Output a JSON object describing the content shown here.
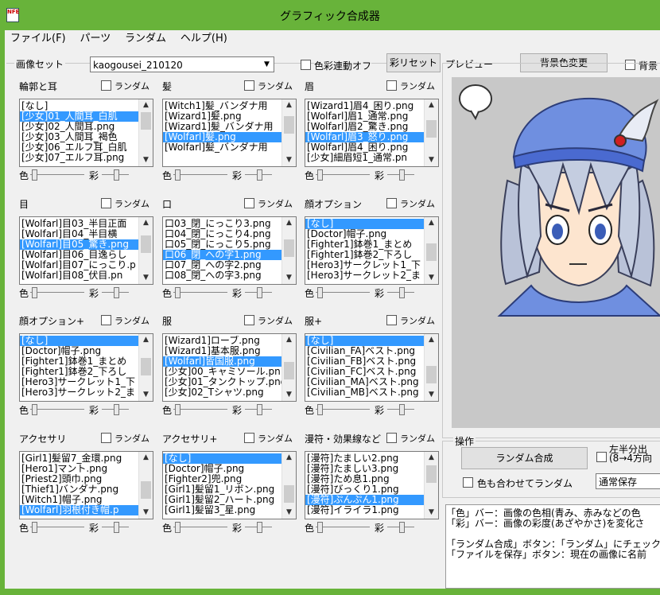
{
  "window": {
    "title": "グラフィック合成器",
    "icon_text": "NFE"
  },
  "menu": [
    "ファイル(F)",
    "パーツ",
    "ランダム",
    "ヘルプ(H)"
  ],
  "image_set": {
    "label": "画像セット",
    "value": "kaogousei_210120",
    "color_link_label": "色彩連動オフ",
    "color_reset_button": "彩リセット"
  },
  "preview": {
    "label": "プレビュー",
    "bg_button": "背景色変更",
    "bg_check_label": "背景",
    "bg_color": "#c8c8c8"
  },
  "common": {
    "random": "ランダム",
    "color": "色",
    "sat": "彩"
  },
  "parts": [
    {
      "label": "輪郭と耳",
      "items": [
        "[なし]",
        "[少女]01_人間耳_白肌",
        "[少女]02_人間耳.png",
        "[少女]03_人間耳_褐色",
        "[少女]06_エルフ耳_白肌",
        "[少女]07_エルフ耳.png"
      ],
      "selected": 1
    },
    {
      "label": "髪",
      "items": [
        "[Witch1]髪_バンダナ用",
        "[Wizard1]髪.png",
        "[Wizard1]髪_バンダナ用",
        "[Wolfarl]髪.png",
        "[Wolfarl]髪_バンダナ用"
      ],
      "selected": 3
    },
    {
      "label": "眉",
      "items": [
        "[Wizard1]眉4_困り.png",
        "[Wolfarl]眉1_通常.png",
        "[Wolfarl]眉2_驚き.png",
        "[Wolfarl]眉3_怒り.png",
        "[Wolfarl]眉4_困り.png",
        "[少女]細眉短1_通常.pn"
      ],
      "selected": 3
    },
    {
      "label": "目",
      "items": [
        "[Wolfarl]目03_半目正面",
        "[Wolfarl]目04_半目横",
        "[Wolfarl]目05_驚き.png",
        "[Wolfarl]目06_目逸らし",
        "[Wolfarl]目07_にっこり.p",
        "[Wolfarl]目08_伏目.pn"
      ],
      "selected": 2
    },
    {
      "label": "口",
      "items": [
        "口03_閉_にっこり3.png",
        "口04_閉_にっこり4.png",
        "口05_閉_にっこり5.png",
        "口06_閉_への字1.png",
        "口07_閉_への字2.png",
        "口08_閉_への字3.png"
      ],
      "selected": 3
    },
    {
      "label": "顔オプション",
      "items": [
        "[なし]",
        "[Doctor]帽子.png",
        "[Fighter1]鉢巻1_まとめ",
        "[Fighter1]鉢巻2_下ろし",
        "[Hero3]サークレット1_下",
        "[Hero3]サークレット2_ま"
      ],
      "selected": 0
    },
    {
      "label": "顔オプション+",
      "items": [
        "[なし]",
        "[Doctor]帽子.png",
        "[Fighter1]鉢巻1_まとめ",
        "[Fighter1]鉢巻2_下ろし",
        "[Hero3]サークレット1_下",
        "[Hero3]サークレット2_ま"
      ],
      "selected": 0
    },
    {
      "label": "服",
      "items": [
        "[Wizard1]ローブ.png",
        "[Wizard1]基本服.png",
        "[Wolfarl]皆国服.png",
        "[少女]00_キャミソール.pn",
        "[少女]01_タンクトップ.png",
        "[少女]02_Tシャツ.png"
      ],
      "selected": 2
    },
    {
      "label": "服+",
      "items": [
        "[なし]",
        "[Civilian_FA]ベスト.png",
        "[Civilian_FB]ベスト.png",
        "[Civilian_FC]ベスト.png",
        "[Civilian_MA]ベスト.png",
        "[Civilian_MB]ベスト.png"
      ],
      "selected": 0
    },
    {
      "label": "アクセサリ",
      "items": [
        "[Girl1]髪留7_金環.png",
        "[Hero1]マント.png",
        "[Priest2]頭巾.png",
        "[Thief1]バンダナ.png",
        "[Witch1]帽子.png",
        "[Wolfarl]羽根付き帽.p"
      ],
      "selected": 5
    },
    {
      "label": "アクセサリ+",
      "items": [
        "[なし]",
        "[Doctor]帽子.png",
        "[Fighter2]兜.png",
        "[Girl1]髪留1_リボン.png",
        "[Girl1]髪留2_ハート.png",
        "[Girl1]髪留3_星.png"
      ],
      "selected": 0
    },
    {
      "label": "漫符・効果線など",
      "items": [
        "[漫符]たましい2.png",
        "[漫符]たましい3.png",
        "[漫符]ため息1.png",
        "[漫符]びっくり1.png",
        "[漫符]ぷんぷん1.png",
        "[漫符]イライラ1.png"
      ],
      "selected": 4
    }
  ],
  "operations": {
    "label": "操作",
    "random_compose_button": "ランダム合成",
    "random_with_color_label": "色も合わせてランダム",
    "split_label_1": "左半分出",
    "split_label_2": "(8→4方向",
    "save_mode": "通常保存"
  },
  "help_text": [
    "「色」バー：画像の色相(青み、赤みなどの色",
    "「彩」バー：画像の彩度(あざやかさ)を変化さ",
    "",
    "「ランダム合成」ボタン：「ランダム」にチェックが",
    "「ファイルを保存」ボタン：現在の画像に名前"
  ]
}
